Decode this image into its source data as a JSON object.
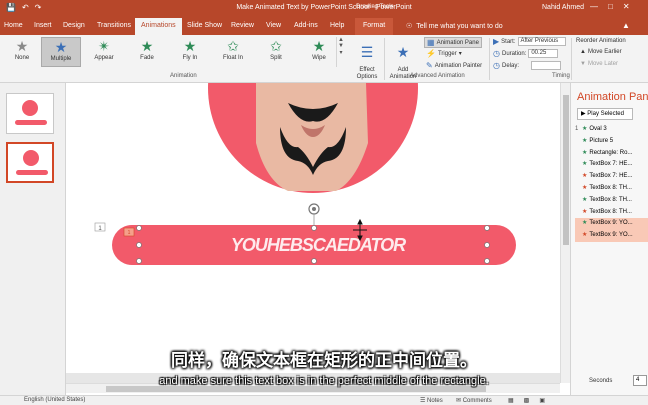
{
  "window": {
    "title": "Make Animated Text by PowerPoint School  -  PowerPoint",
    "context_group": "Drawing Tools",
    "user": "Nahid Ahmed"
  },
  "tabs": [
    "Home",
    "Insert",
    "Design",
    "Transitions",
    "Animations",
    "Slide Show",
    "Review",
    "View",
    "Add-ins",
    "Help"
  ],
  "active_tab": "Animations",
  "context_tab": "Format",
  "tell_me": "Tell me what you want to do",
  "ribbon": {
    "animations": [
      "None",
      "Multiple",
      "Appear",
      "Fade",
      "Fly In",
      "Float In",
      "Split",
      "Wipe"
    ],
    "selected_animation": "Multiple",
    "effect_options": "Effect\nOptions",
    "animation_group_label": "Animation",
    "add_animation": "Add\nAnimation",
    "animation_pane": "Animation Pane",
    "trigger": "Trigger",
    "animation_painter": "Animation Painter",
    "advanced_group_label": "Advanced Animation",
    "start_label": "Start:",
    "start_value": "After Previous",
    "duration_label": "Duration:",
    "duration_value": "00.25",
    "delay_label": "Delay:",
    "delay_value": "",
    "reorder": "Reorder Animation",
    "move_earlier": "Move Earlier",
    "move_later": "Move Later",
    "timing_group_label": "Timing"
  },
  "slide": {
    "text": "YOUHEBSCAEDATOR",
    "tag": "1",
    "number_marker": "1"
  },
  "animation_pane": {
    "title": "Animation Pane",
    "play_button": "Play Selected",
    "items": [
      {
        "num": "1",
        "label": "Oval 3",
        "color": "#2e8b57",
        "highlight": false
      },
      {
        "num": "",
        "label": "Picture 5",
        "color": "#2e8b57",
        "highlight": false
      },
      {
        "num": "",
        "label": "Rectangle: Ro...",
        "color": "#2e8b57",
        "highlight": false
      },
      {
        "num": "",
        "label": "TextBox 7: HE...",
        "color": "#2e8b57",
        "highlight": false
      },
      {
        "num": "",
        "label": "TextBox 7: HE...",
        "color": "#d24726",
        "highlight": false
      },
      {
        "num": "",
        "label": "TextBox 8: TH...",
        "color": "#d24726",
        "highlight": false
      },
      {
        "num": "",
        "label": "TextBox 8: TH...",
        "color": "#2e8b57",
        "highlight": false
      },
      {
        "num": "",
        "label": "TextBox 8: TH...",
        "color": "#d24726",
        "highlight": false
      },
      {
        "num": "",
        "label": "TextBox 9: YO...",
        "color": "#2e8b57",
        "highlight": true
      },
      {
        "num": "",
        "label": "TextBox 9: YO...",
        "color": "#d24726",
        "highlight": true
      }
    ],
    "seconds_label": "Seconds",
    "seconds_value": "4"
  },
  "status": {
    "language": "English (United States)",
    "notes": "Notes",
    "comments": "Comments"
  },
  "captions": {
    "chinese": "同样，确保文本框在矩形的正中间位置。",
    "english": "and make sure this text box is in the perfect middle of the rectangle."
  },
  "colors": {
    "accent": "#b7472a",
    "pink": "#f25a6a",
    "pane_title": "#d24726"
  }
}
